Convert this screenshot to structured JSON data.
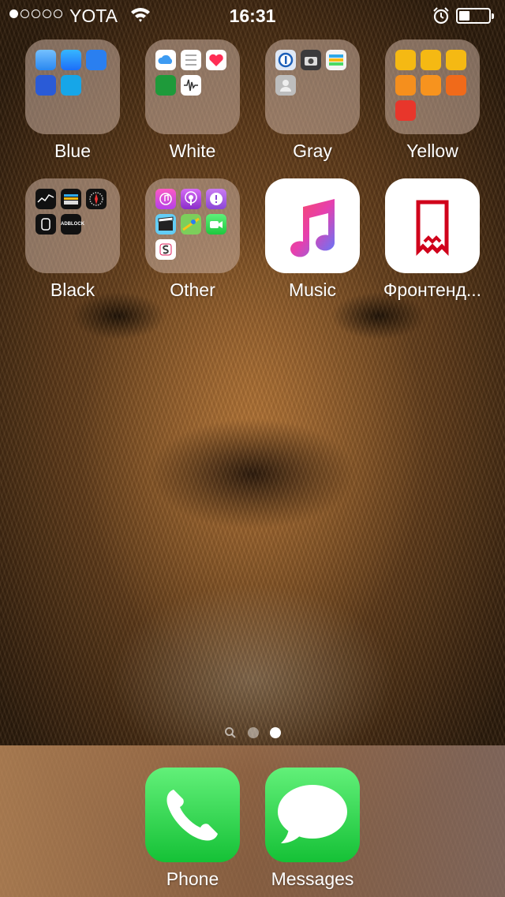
{
  "status_bar": {
    "signal_bars": 1,
    "signal_total": 5,
    "carrier": "YOTA",
    "time": "16:31",
    "battery_level": 0.35
  },
  "home": {
    "rows": [
      [
        {
          "label": "Blue",
          "kind": "folder",
          "icons": [
            "weather-icon",
            "app-store-icon",
            "touch-icon",
            "outlook-icon",
            "skype-icon"
          ]
        },
        {
          "label": "White",
          "kind": "folder",
          "icons": [
            "icloud-icon",
            "reminders-icon",
            "health-icon",
            "find-friends-icon",
            "voice-memos-icon"
          ]
        },
        {
          "label": "Gray",
          "kind": "folder",
          "icons": [
            "1password-icon",
            "camera-icon",
            "wallet-pass-icon",
            "contacts-icon"
          ]
        },
        {
          "label": "Yellow",
          "kind": "folder",
          "icons": [
            "settings-gold-icon",
            "family-icon",
            "tips-icon",
            "calculator-icon",
            "ibooks-icon",
            "timer-icon",
            "bookmark-app-icon"
          ]
        }
      ],
      [
        {
          "label": "Black",
          "kind": "folder",
          "icons": [
            "stocks-icon",
            "wallet-icon",
            "compass-icon",
            "watch-icon",
            "adblock-icon"
          ]
        },
        {
          "label": "Other",
          "kind": "folder",
          "icons": [
            "itunes-icon",
            "podcasts-icon",
            "feedback-icon",
            "clips-icon",
            "maps-icon",
            "facetime-icon",
            "slack-icon"
          ]
        },
        {
          "label": "Music",
          "kind": "app",
          "icon": "music-note-icon"
        },
        {
          "label": "Фронтенд...",
          "kind": "app",
          "icon": "red-bookmark-icon"
        }
      ]
    ],
    "adblock_text": "ADBLOCK"
  },
  "page_control": {
    "pages": 2,
    "current": 2
  },
  "dock": {
    "apps": [
      {
        "label": "Phone",
        "icon": "phone-icon"
      },
      {
        "label": "Messages",
        "icon": "message-bubble-icon"
      }
    ]
  },
  "colors": {
    "weather": "#4aa3f5",
    "appstore": "#1d8cf8",
    "touch": "#2a7ff0",
    "outlook": "#2a5bd7",
    "skype": "#16a6e8",
    "icloud": "#ffffff",
    "reminders": "#ffffff",
    "health": "#ffffff",
    "findfriends": "#1e9a3a",
    "voicememos": "#ffffff",
    "onepassword": "#dfe8f5",
    "camera": "#3a3a3c",
    "wallet_pass": "#f4f4f4",
    "contacts": "#bdbdbd",
    "yellow": "#f5b913",
    "orange": "#f58f1d",
    "ibooks": "#f7931e",
    "red": "#e8362b",
    "music_gradient_start": "#fc4c8b",
    "music_gradient_end": "#6e5bff",
    "frontend_red": "#d0021b"
  }
}
